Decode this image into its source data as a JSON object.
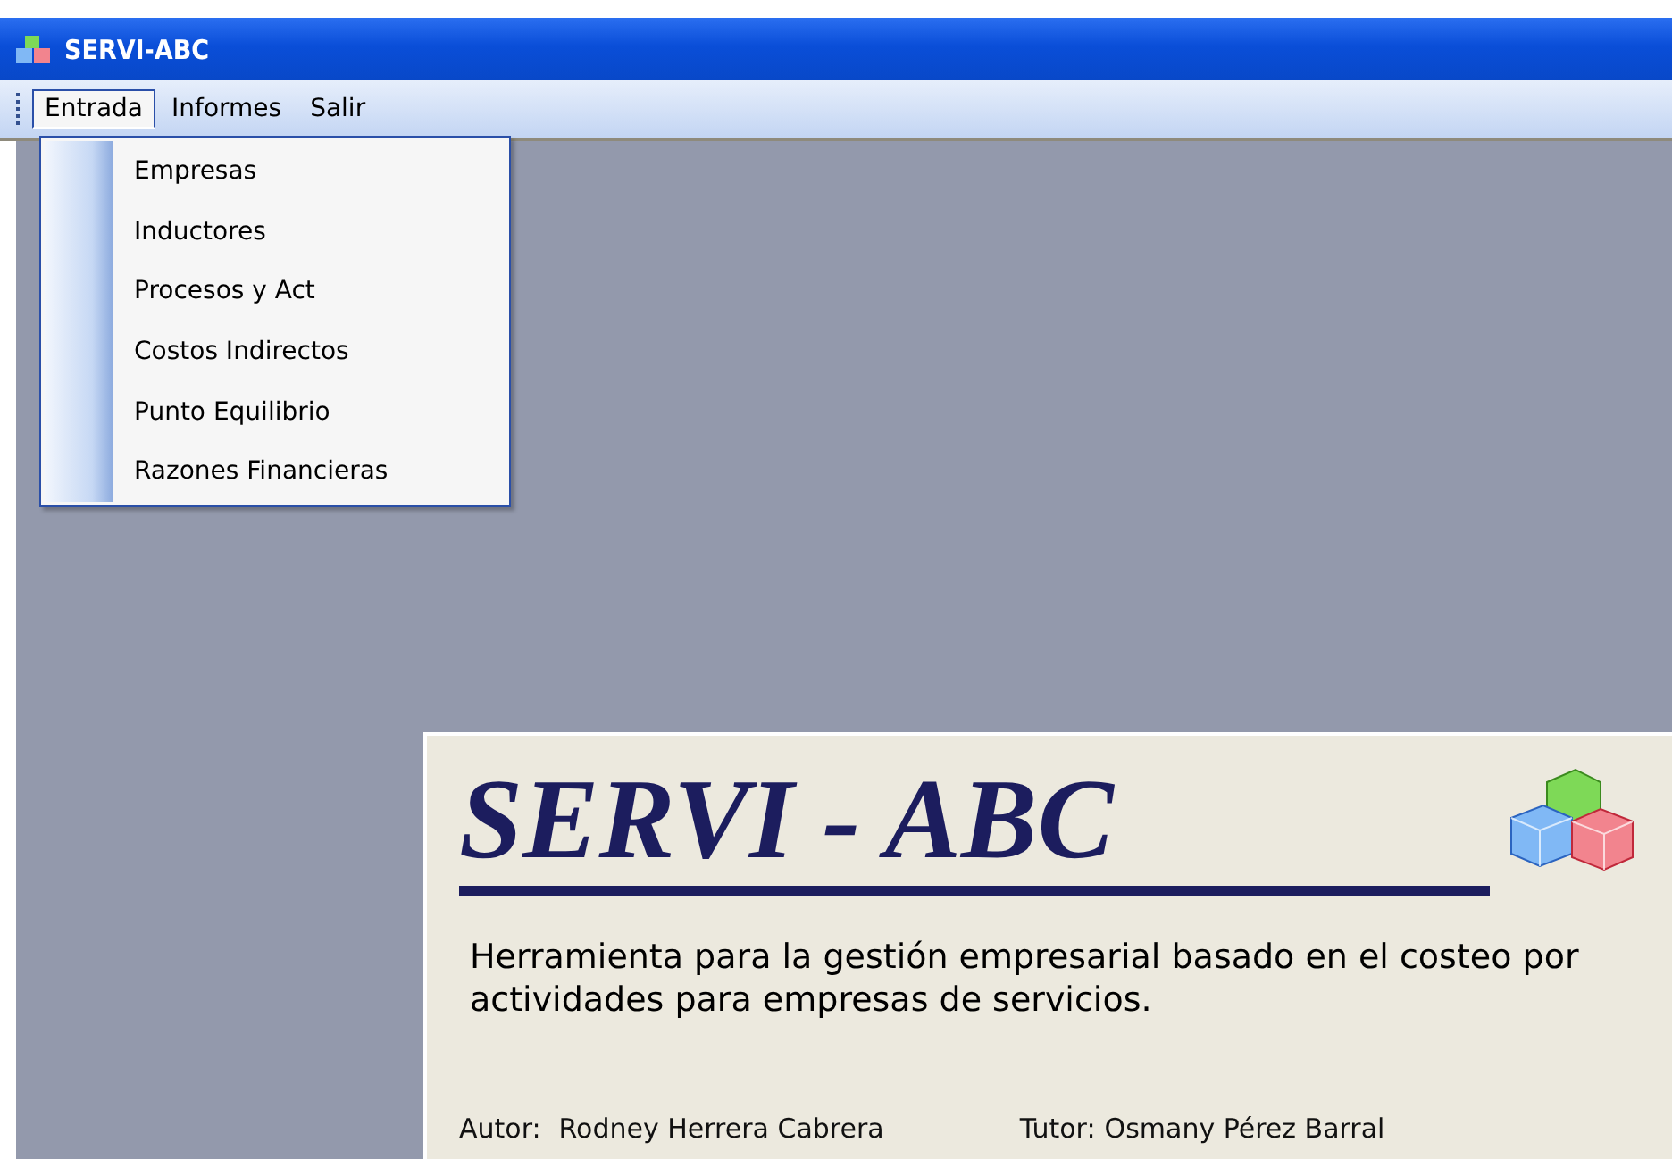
{
  "window": {
    "title": "SERVI-ABC"
  },
  "menu_bar": {
    "items": [
      {
        "label": "Entrada",
        "selected": true
      },
      {
        "label": "Informes",
        "selected": false
      },
      {
        "label": "Salir",
        "selected": false
      }
    ]
  },
  "dropdown": {
    "items": [
      {
        "label": "Empresas"
      },
      {
        "label": "Inductores"
      },
      {
        "label": "Procesos y Act"
      },
      {
        "label": "Costos Indirectos"
      },
      {
        "label": "Punto Equilibrio"
      },
      {
        "label": "Razones Financieras"
      }
    ]
  },
  "splash": {
    "title": "SERVI - ABC",
    "description": "Herramienta para la gestión empresarial basado en el costeo por actividades para empresas de servicios.",
    "author_label": "Autor:",
    "author": "Rodney Herrera Cabrera",
    "tutor_label": "Tutor:",
    "tutor": "Osmany Pérez Barral"
  }
}
